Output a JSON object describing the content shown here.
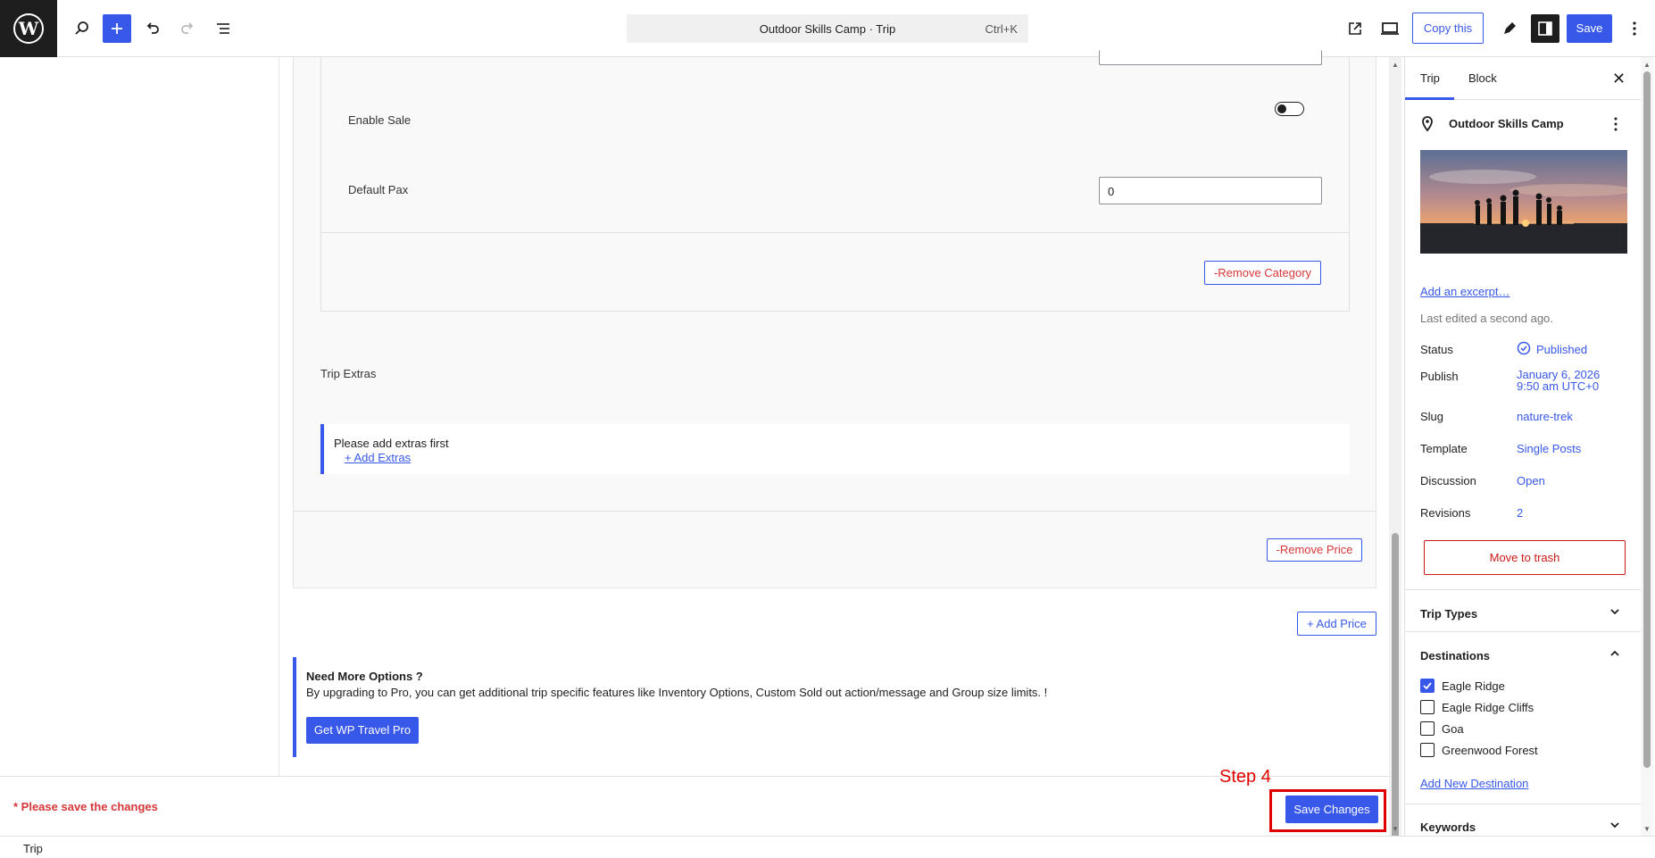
{
  "topbar": {
    "document_title": "Outdoor Skills Camp · Trip",
    "shortcut": "Ctrl+K",
    "copy_label": "Copy this",
    "save_label": "Save"
  },
  "editor": {
    "enable_sale_label": "Enable Sale",
    "default_pax_label": "Default Pax",
    "default_pax_value": "0",
    "remove_category_label": "-Remove Category",
    "trip_extras_label": "Trip Extras",
    "extras_notice_text": "Please add extras first",
    "add_extras_label": "+ Add Extras",
    "remove_price_label": "-Remove Price",
    "add_price_label": "+ Add Price",
    "upsell_title": "Need More Options ?",
    "upsell_text": "By upgrading to Pro, you can get additional trip specific features like Inventory Options, Custom Sold out action/message and Group size limits. !",
    "get_pro_label": "Get WP Travel Pro"
  },
  "footer": {
    "save_note": "* Please save the changes",
    "step_label": "Step 4",
    "save_changes_label": "Save Changes"
  },
  "statusbar": {
    "breadcrumb": "Trip"
  },
  "sidebar": {
    "tabs": [
      {
        "label": "Trip",
        "active": true
      },
      {
        "label": "Block",
        "active": false
      }
    ],
    "post_title": "Outdoor Skills Camp",
    "add_excerpt_label": "Add an excerpt…",
    "last_edited": "Last edited a second ago.",
    "rows": [
      {
        "label": "Status",
        "value": "Published"
      },
      {
        "label": "Publish",
        "value": "January 6, 2026",
        "value2": "9:50 am UTC+0"
      },
      {
        "label": "Slug",
        "value": "nature-trek"
      },
      {
        "label": "Template",
        "value": "Single Posts"
      },
      {
        "label": "Discussion",
        "value": "Open"
      },
      {
        "label": "Revisions",
        "value": "2"
      }
    ],
    "trash_label": "Move to trash",
    "trip_types_title": "Trip Types",
    "destinations_title": "Destinations",
    "destinations": [
      {
        "label": "Eagle Ridge",
        "checked": true
      },
      {
        "label": "Eagle Ridge Cliffs",
        "checked": false
      },
      {
        "label": "Goa",
        "checked": false
      },
      {
        "label": "Greenwood Forest",
        "checked": false
      }
    ],
    "add_destination_label": "Add New Destination",
    "keywords_title": "Keywords"
  },
  "icons": {
    "logo": "wordpress-logo-icon",
    "search": "search-icon",
    "add": "plus-icon",
    "undo": "undo-icon",
    "redo": "redo-icon",
    "outline": "document-outline-icon",
    "view_post": "external-link-icon",
    "preview": "laptop-preview-icon",
    "styles": "pen-icon",
    "settings": "sidebar-toggle-icon",
    "options": "more-vertical-icon",
    "close": "close-icon",
    "location": "location-pin-icon",
    "status": "published-check-icon"
  },
  "colors": {
    "accent": "#3858e9",
    "danger": "#d63638",
    "highlight": "#e00000"
  }
}
